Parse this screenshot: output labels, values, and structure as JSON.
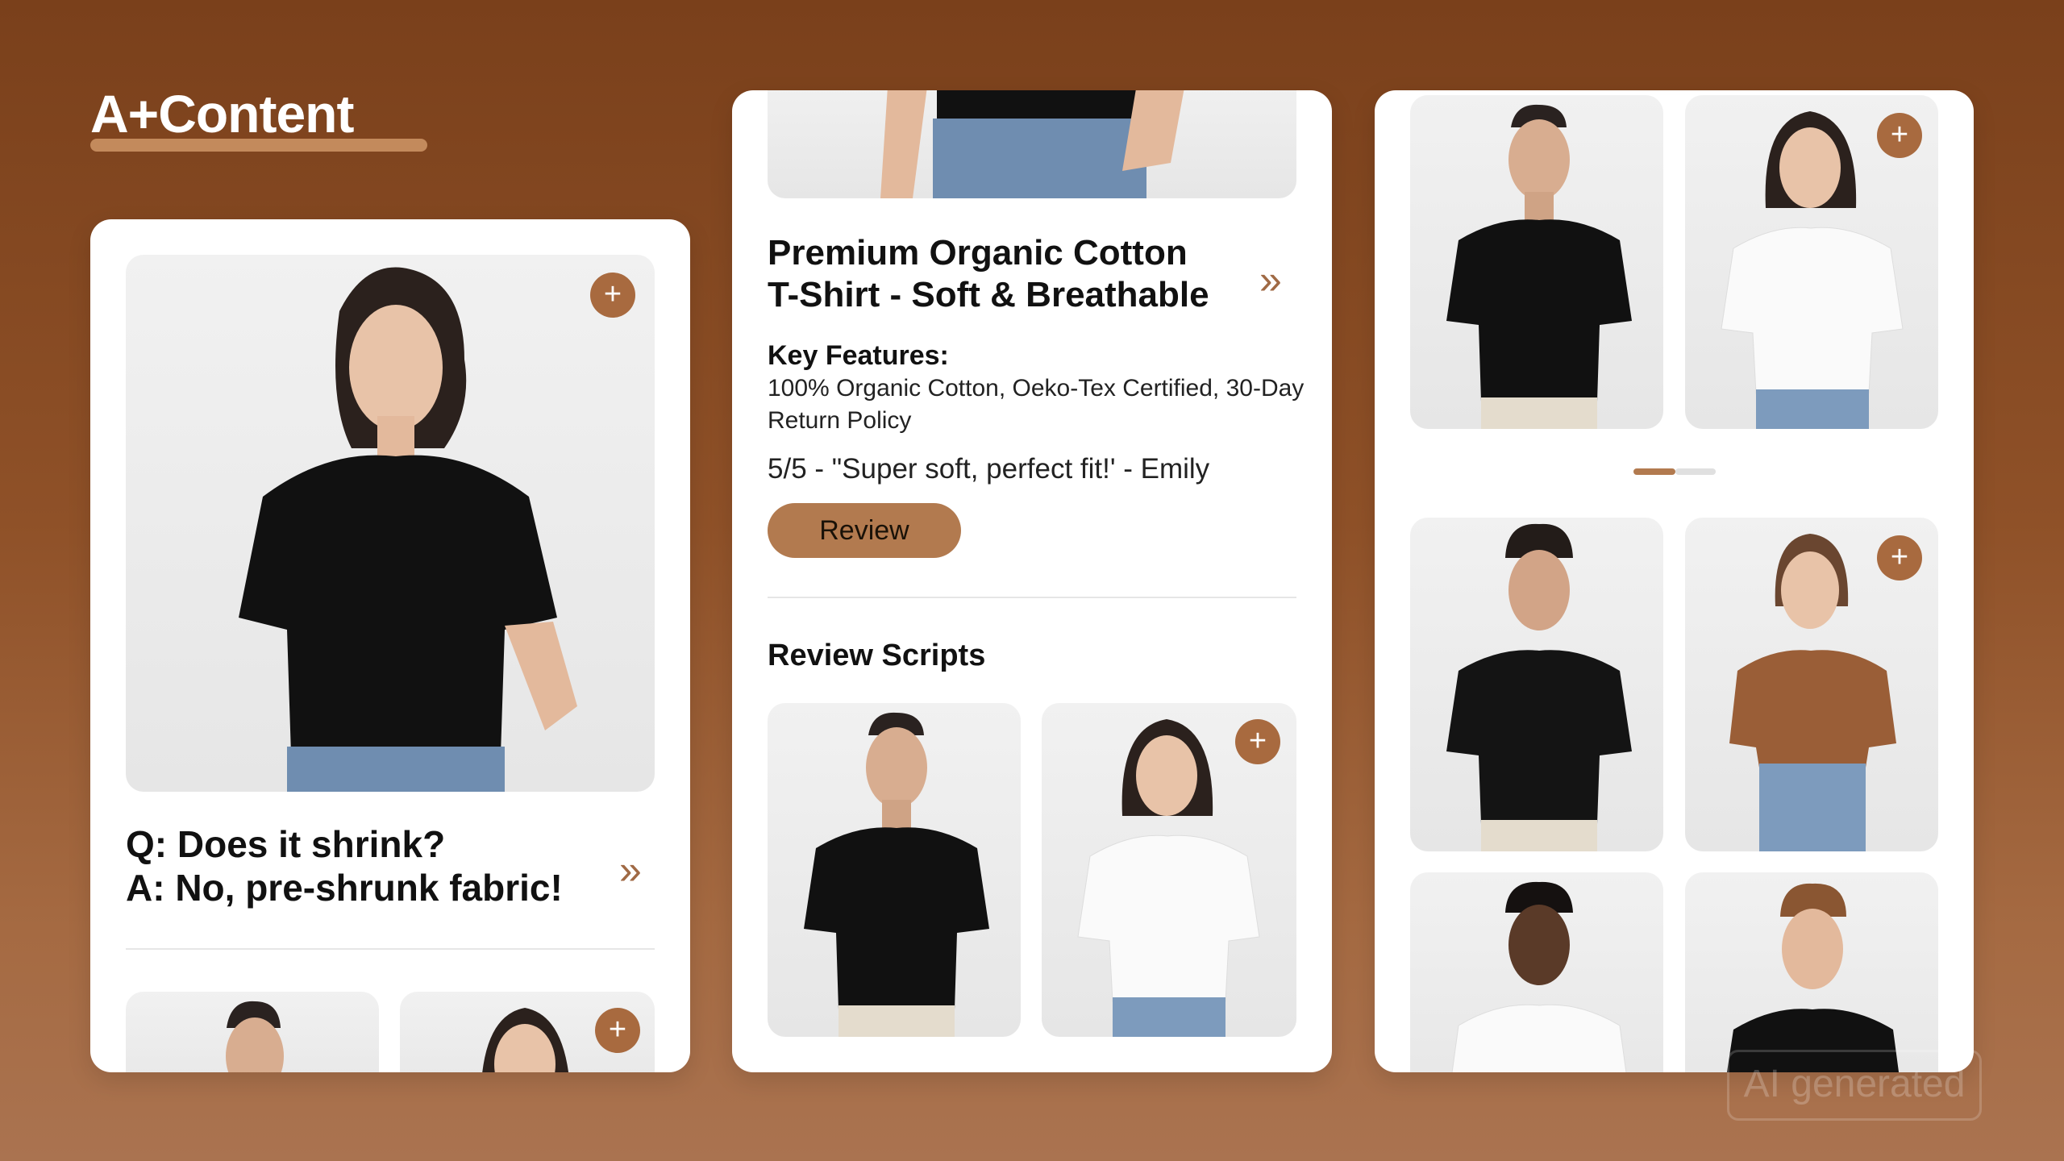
{
  "logo": {
    "text": "A+Content"
  },
  "left_card": {
    "faq_question": "Q: Does it shrink?",
    "faq_answer": "A: No, pre-shrunk fabric!",
    "chevron": "»",
    "plus": "+"
  },
  "middle_card": {
    "title_line1": "Premium Organic Cotton",
    "title_line2": "T-Shirt - Soft & Breathable",
    "chevron": "»",
    "key_features_label": "Key Features:",
    "key_features_line1": "100% Organic Cotton, Oeko-Tex Certified, 30-Day",
    "key_features_line2": "Return Policy",
    "review_quote": "5/5 - \"Super soft, perfect fit!' - Emily",
    "review_button": "Review",
    "section_heading": "Review Scripts",
    "plus": "+"
  },
  "right_card": {
    "plus": "+",
    "carousel": {
      "active_index": 0,
      "total": 2
    }
  },
  "watermark": "AI generated",
  "colors": {
    "accent": "#b27a4f",
    "background": "#8f5128",
    "card": "#ffffff",
    "plus_button": "#a86a3f"
  },
  "icons": [
    "plus-icon",
    "double-chevron-right-icon"
  ]
}
